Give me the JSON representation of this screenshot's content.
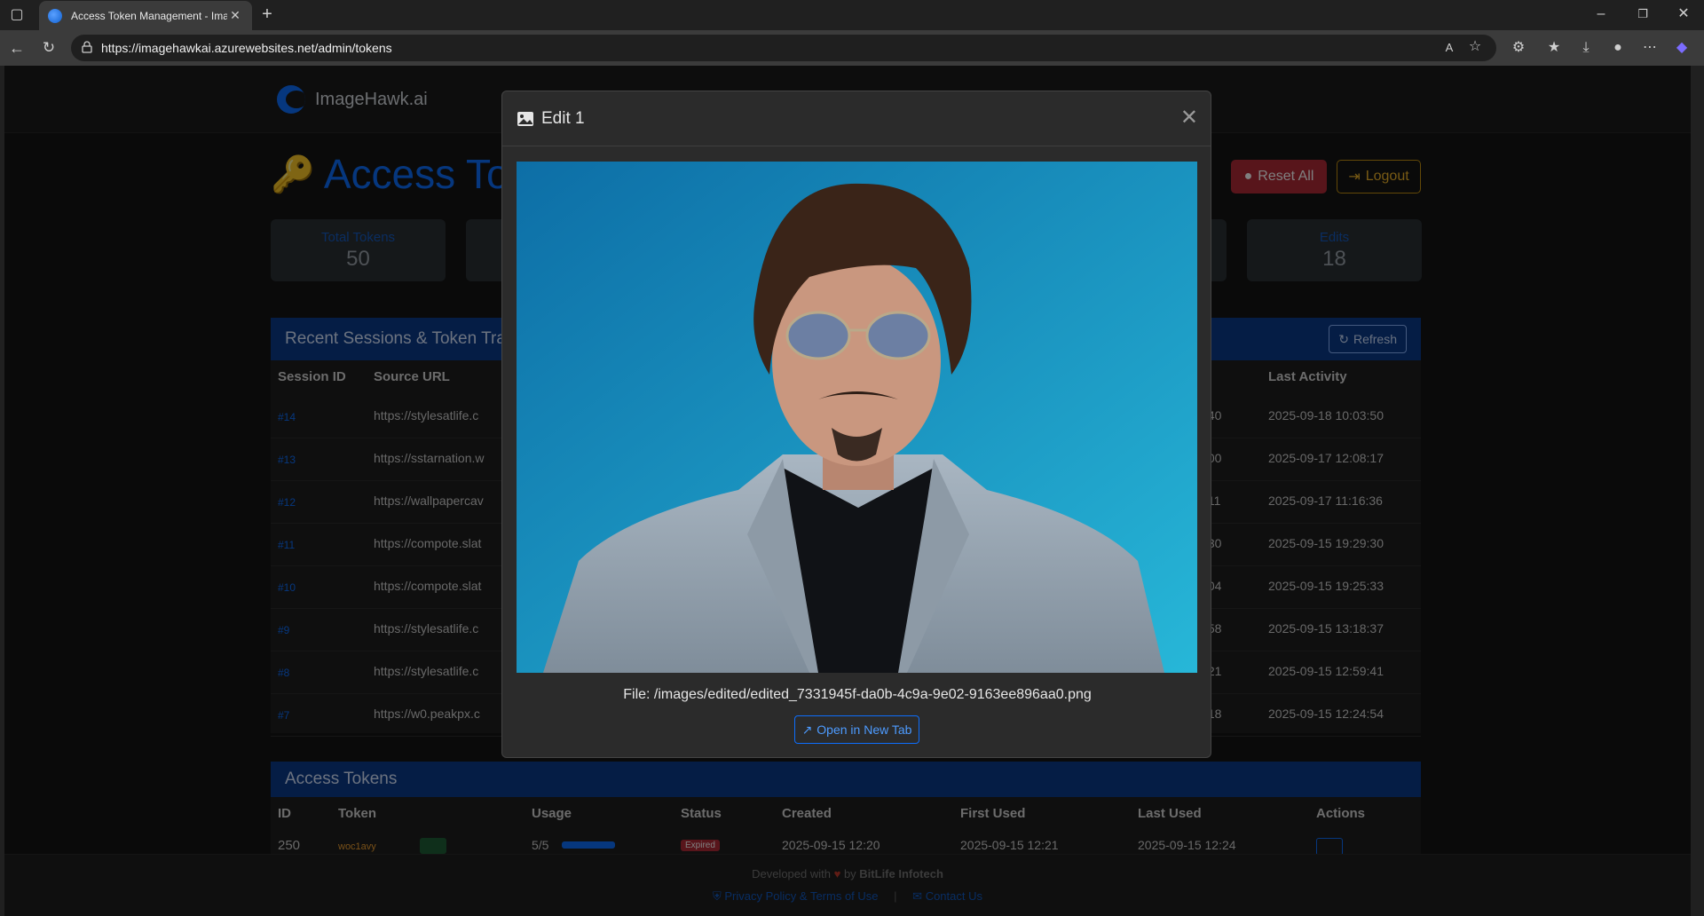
{
  "browser": {
    "tab_title": "Access Token Management - Ima",
    "url": "https://imagehawkai.azurewebsites.net/admin/tokens"
  },
  "nav": {
    "brand": "ImageHawk.ai"
  },
  "header": {
    "title": "Access Toke",
    "reset_label": "Reset All",
    "logout_label": "Logout"
  },
  "stats": {
    "total_label": "Total Tokens",
    "total_value": "50",
    "edits_label": "Edits",
    "edits_value": "18"
  },
  "sessions": {
    "title": "Recent Sessions & Token Tra",
    "refresh_label": "Refresh",
    "columns": {
      "id": "Session ID",
      "url": "Source URL",
      "last": "Last Activity"
    },
    "rows": [
      {
        "id": "#14",
        "url": "https://stylesatlife.c",
        "mid": ":40",
        "last": "2025-09-18 10:03:50"
      },
      {
        "id": "#13",
        "url": "https://sstarnation.w",
        "mid": ":00",
        "last": "2025-09-17 12:08:17"
      },
      {
        "id": "#12",
        "url": "https://wallpapercav",
        "mid": ":11",
        "last": "2025-09-17 11:16:36"
      },
      {
        "id": "#11",
        "url": "https://compote.slat",
        "mid": ":30",
        "last": "2025-09-15 19:29:30"
      },
      {
        "id": "#10",
        "url": "https://compote.slat",
        "mid": ":04",
        "last": "2025-09-15 19:25:33"
      },
      {
        "id": "#9",
        "url": "https://stylesatlife.c",
        "mid": ":58",
        "last": "2025-09-15 13:18:37"
      },
      {
        "id": "#8",
        "url": "https://stylesatlife.c",
        "mid": ":21",
        "last": "2025-09-15 12:59:41"
      },
      {
        "id": "#7",
        "url": "https://w0.peakpx.c",
        "mid": ":18",
        "last": "2025-09-15 12:24:54"
      }
    ]
  },
  "tokens": {
    "title": "Access Tokens",
    "columns": {
      "id": "ID",
      "token": "Token",
      "usage": "Usage",
      "status": "Status",
      "created": "Created",
      "first": "First Used",
      "last": "Last Used",
      "actions": "Actions"
    },
    "row": {
      "id": "250",
      "token": "woc1avy",
      "usage": "5/5",
      "status": "Expired",
      "created": "2025-09-15 12:20",
      "first": "2025-09-15 12:21",
      "last": "2025-09-15 12:24"
    }
  },
  "footer": {
    "developed": "Developed with",
    "by": "by",
    "company": "BitLife Infotech",
    "privacy": "Privacy Policy & Terms of Use",
    "separator": "|",
    "contact": "Contact Us"
  },
  "modal": {
    "title": "Edit 1",
    "file": "File: /images/edited/edited_7331945f-da0b-4c9a-9e02-9163ee896aa0.png",
    "open_label": "Open in New Tab"
  },
  "colors": {
    "primary": "#0d6efd",
    "danger": "#b02a37",
    "warning": "#f0b429"
  }
}
